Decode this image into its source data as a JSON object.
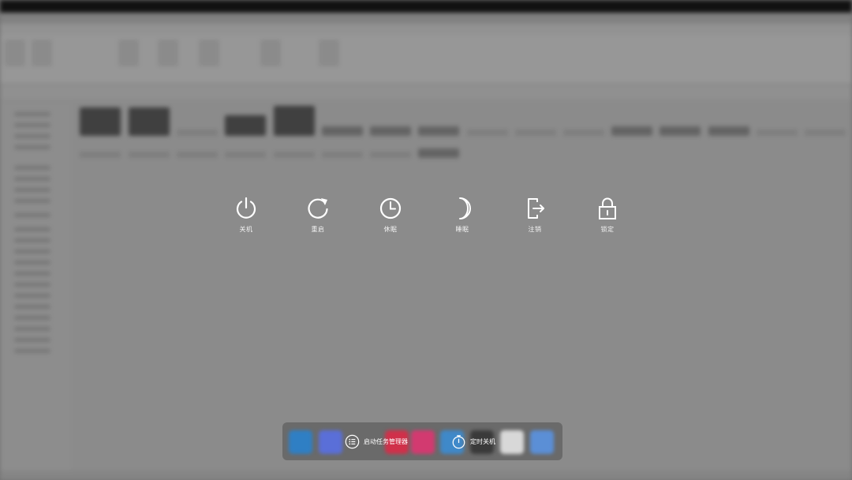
{
  "power_menu": {
    "items": [
      {
        "id": "shutdown",
        "label": "关机",
        "icon": "power-icon"
      },
      {
        "id": "restart",
        "label": "重启",
        "icon": "restart-icon"
      },
      {
        "id": "sleep",
        "label": "休眠",
        "icon": "clock-icon"
      },
      {
        "id": "hibernate",
        "label": "睡眠",
        "icon": "moon-icon"
      },
      {
        "id": "logout",
        "label": "注销",
        "icon": "logout-icon"
      },
      {
        "id": "lock",
        "label": "锁定",
        "icon": "lock-icon"
      }
    ]
  },
  "dock": {
    "task_manager_label": "启动任务管理器",
    "timed_shutdown_label": "定时关机",
    "app_colors": [
      "#2f7fc4",
      "#5a6fd8",
      "#7a7a7a",
      "#d0304a",
      "#d23a70",
      "#3f89c9",
      "#3a3a3a",
      "#d8d8d8",
      "#5b8fd6"
    ]
  },
  "colors": {
    "icon": "#ffffff",
    "overlay": "#7d7d7d"
  }
}
